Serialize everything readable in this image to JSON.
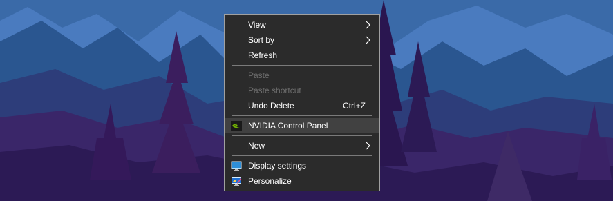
{
  "wallpaper": {
    "description_colors": {
      "sky": "#3a6aa8",
      "far_mountains": "#4a77b4",
      "mid_mountains": "#285487",
      "near_hills": "#3b2d6e",
      "foreground": "#2a1a56",
      "ground": "#3b205e"
    }
  },
  "context_menu": {
    "groups": [
      [
        {
          "label": "View",
          "submenu": true,
          "enabled": true
        },
        {
          "label": "Sort by",
          "submenu": true,
          "enabled": true
        },
        {
          "label": "Refresh",
          "submenu": false,
          "enabled": true
        }
      ],
      [
        {
          "label": "Paste",
          "submenu": false,
          "enabled": false
        },
        {
          "label": "Paste shortcut",
          "submenu": false,
          "enabled": false
        },
        {
          "label": "Undo Delete",
          "shortcut": "Ctrl+Z",
          "submenu": false,
          "enabled": true
        }
      ],
      [
        {
          "label": "NVIDIA Control Panel",
          "icon": "nvidia-icon",
          "submenu": false,
          "enabled": true,
          "highlighted": true
        }
      ],
      [
        {
          "label": "New",
          "submenu": true,
          "enabled": true
        }
      ],
      [
        {
          "label": "Display settings",
          "icon": "monitor-icon",
          "submenu": false,
          "enabled": true
        },
        {
          "label": "Personalize",
          "icon": "personalize-icon",
          "submenu": false,
          "enabled": true
        }
      ]
    ],
    "colors": {
      "background": "#2b2b2b",
      "border": "#a0a0a0",
      "text": "#ffffff",
      "disabled_text": "#6d6d6d",
      "highlight": "#414141",
      "separator": "#7a7a7a",
      "nvidia_green": "#76b900"
    }
  }
}
